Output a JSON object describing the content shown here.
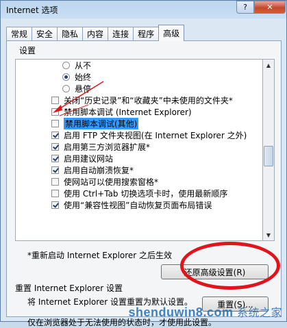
{
  "window": {
    "title": "Internet 选项",
    "help_symbol": "?",
    "close_symbol": "✕"
  },
  "tabs": [
    {
      "label": "常规"
    },
    {
      "label": "安全"
    },
    {
      "label": "隐私"
    },
    {
      "label": "内容"
    },
    {
      "label": "连接"
    },
    {
      "label": "程序"
    },
    {
      "label": "高级"
    }
  ],
  "settings": {
    "label": "设置",
    "items": [
      {
        "kind": "radio",
        "checked": false,
        "label": "从不"
      },
      {
        "kind": "radio",
        "checked": true,
        "label": "始终"
      },
      {
        "kind": "radio",
        "checked": false,
        "label": "悬停"
      },
      {
        "kind": "checkbox",
        "checked": false,
        "label": "关闭“历史记录”和“收藏夹”中未使用的文件夹*"
      },
      {
        "kind": "checkbox",
        "checked": false,
        "label": "禁用脚本调试 (Internet Explorer)"
      },
      {
        "kind": "checkbox",
        "checked": false,
        "label": "禁用脚本调试(其他)",
        "highlighted": true
      },
      {
        "kind": "checkbox",
        "checked": true,
        "label": "启用 FTP 文件夹视图(在 Internet Explorer 之外)"
      },
      {
        "kind": "checkbox",
        "checked": true,
        "label": "启用第三方浏览器扩展*"
      },
      {
        "kind": "checkbox",
        "checked": true,
        "label": "启用建议网站"
      },
      {
        "kind": "checkbox",
        "checked": true,
        "label": "启用自动崩溃恢复*"
      },
      {
        "kind": "checkbox",
        "checked": false,
        "label": "使网站可以使用搜索窗格*"
      },
      {
        "kind": "checkbox",
        "checked": false,
        "label": "使用 Ctrl+Tab 切换选项卡时，使用最新顺序"
      },
      {
        "kind": "checkbox",
        "checked": true,
        "label": "使用“兼容性视图”自动恢复页面布局错误"
      }
    ],
    "restart_note": "*重新启动 Internet Explorer 之后生效",
    "restore_button": "还原高级设置(R)"
  },
  "reset": {
    "title": "重置 Internet Explorer 设置",
    "description": "将 Internet Explorer 设置重置为默认设置。",
    "button": "重置(S)...",
    "warning": "仅在浏览器处于无法使用的状态时，才使用此设置。"
  },
  "annotation_colors": {
    "mark": "#e0141b"
  },
  "watermark": {
    "text": "shenduwin8.com",
    "cn": "系统之家"
  }
}
